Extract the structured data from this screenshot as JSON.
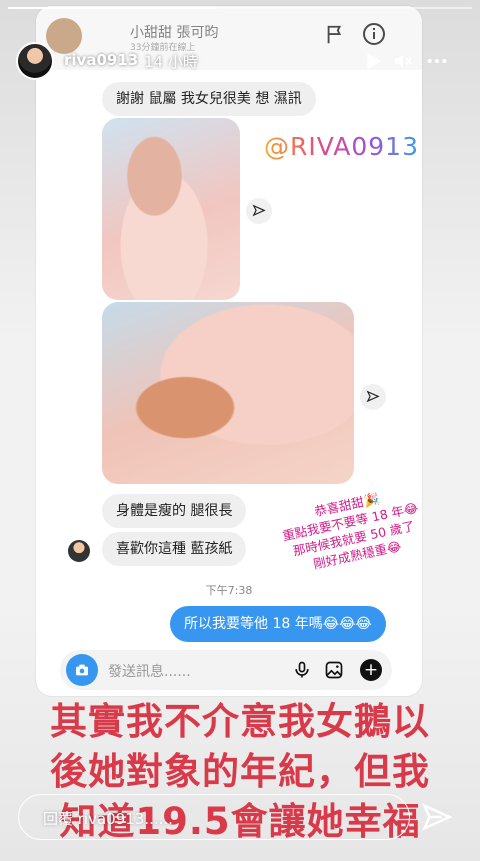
{
  "story": {
    "username": "riva0913",
    "time": "14 小時",
    "progress": 0.45,
    "overlay_lines": [
      "其實我不介意我女鵝以",
      "後她對象的年紀，但我",
      "知道19.5會讓她幸福"
    ],
    "reply_placeholder": "回覆 riva0913......",
    "overlay_color": "#d83a4a"
  },
  "dm": {
    "contact_name": "小甜甜 張可昀",
    "status": "33分鐘前在線上",
    "watermark": "@RIVA0913",
    "messages": {
      "thanks": "謝謝 鼠屬  我女兒很美 想 濕訊",
      "body_thin": "身體是瘦的 腿很長",
      "like_boy": "喜歡你這種 藍孩紙",
      "timestamp": "下午7:38",
      "sent": "所以我要等他 18 年嗎😂😂😂"
    },
    "note_lines": [
      "恭喜甜甜🎉",
      "重點我要不要等 18 年😂",
      "那時候我就要 50 歲了",
      "剛好成熟穩重😂"
    ],
    "note_color": "#d21c8a",
    "composer_placeholder": "發送訊息......",
    "accent": "#3797f0"
  }
}
